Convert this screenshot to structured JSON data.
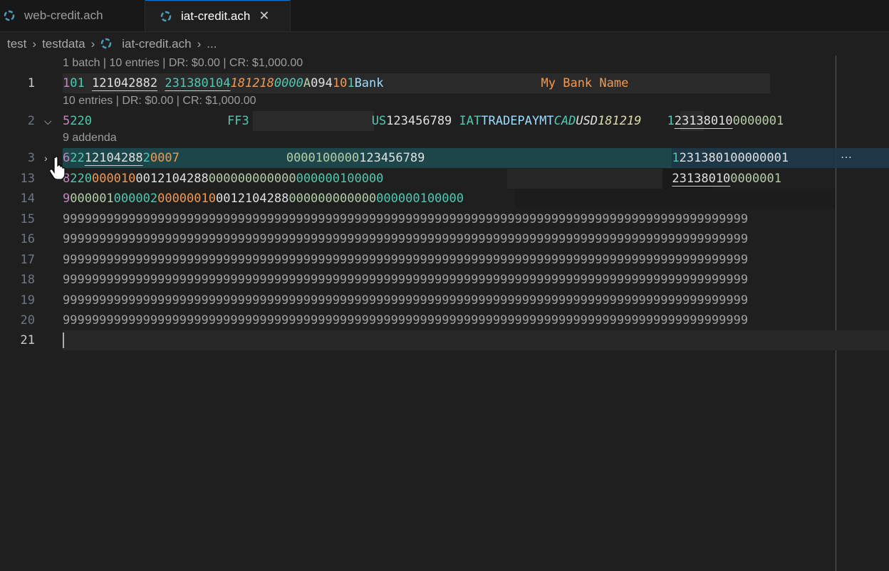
{
  "tabs": [
    {
      "label": "web-credit.ach",
      "icon": "ach-file-icon"
    },
    {
      "label": "iat-credit.ach",
      "icon": "ach-file-icon",
      "active": true,
      "close": "✕"
    }
  ],
  "breadcrumb": {
    "items": [
      "test",
      "testdata",
      "iat-credit.ach",
      "..."
    ]
  },
  "codelens": {
    "file": "1 batch | 10 entries | DR: $0.00 | CR: $1,000.00",
    "batch": "10 entries | DR: $0.00 | CR: $1,000.00",
    "addenda": "9 addenda"
  },
  "lines": {
    "n1": "1",
    "n2": "2",
    "n3": "3",
    "n13": "13",
    "n14": "14",
    "n15": "15",
    "n16": "16",
    "n17": "17",
    "n18": "18",
    "n19": "19",
    "n20": "20",
    "n21": "21",
    "l1": {
      "a": "1",
      "b": "01",
      "c": " ",
      "d": "121042882",
      "e": " ",
      "f": "231380104",
      "g": "181218",
      "h": "0000",
      "i": "A",
      "j": "094",
      "k": "10",
      "l": "1",
      "m": "Bank",
      "n": "My Bank Name"
    },
    "l2": {
      "a": "5",
      "b": "220",
      "c": "FF3",
      "d": "US",
      "e": "123456789",
      "f": " IAT",
      "g": "TRADEPAYMT",
      "h": "CAD",
      "i": "USD",
      "j": "181219",
      "k": "1",
      "l": "23138010",
      "m": "0000001"
    },
    "l3": {
      "a": "6",
      "b": "22",
      "c": "12104288",
      "d": "2",
      "e": "0007",
      "f": "0000100000",
      "g": "123456789",
      "h": "1",
      "i": "231380100000001",
      "more": "⋯"
    },
    "l13": {
      "a": "8",
      "b": "220",
      "c": "000010",
      "d": "0012104288",
      "e": "000000000000",
      "f": "000000100000",
      "g": "23138010",
      "h": "0000001"
    },
    "l14": {
      "a": "9",
      "b": "000001",
      "c": "000002",
      "d": "00000010",
      "e": "0012104288",
      "f": "000000000000",
      "g": "000000100000"
    },
    "nines": "9999999999999999999999999999999999999999999999999999999999999999999999999999999999999999999999"
  },
  "colors": {
    "accent": "#0078d4",
    "teal": "#4ec9b0",
    "orange": "#f3994f",
    "pink": "#c586c0"
  }
}
